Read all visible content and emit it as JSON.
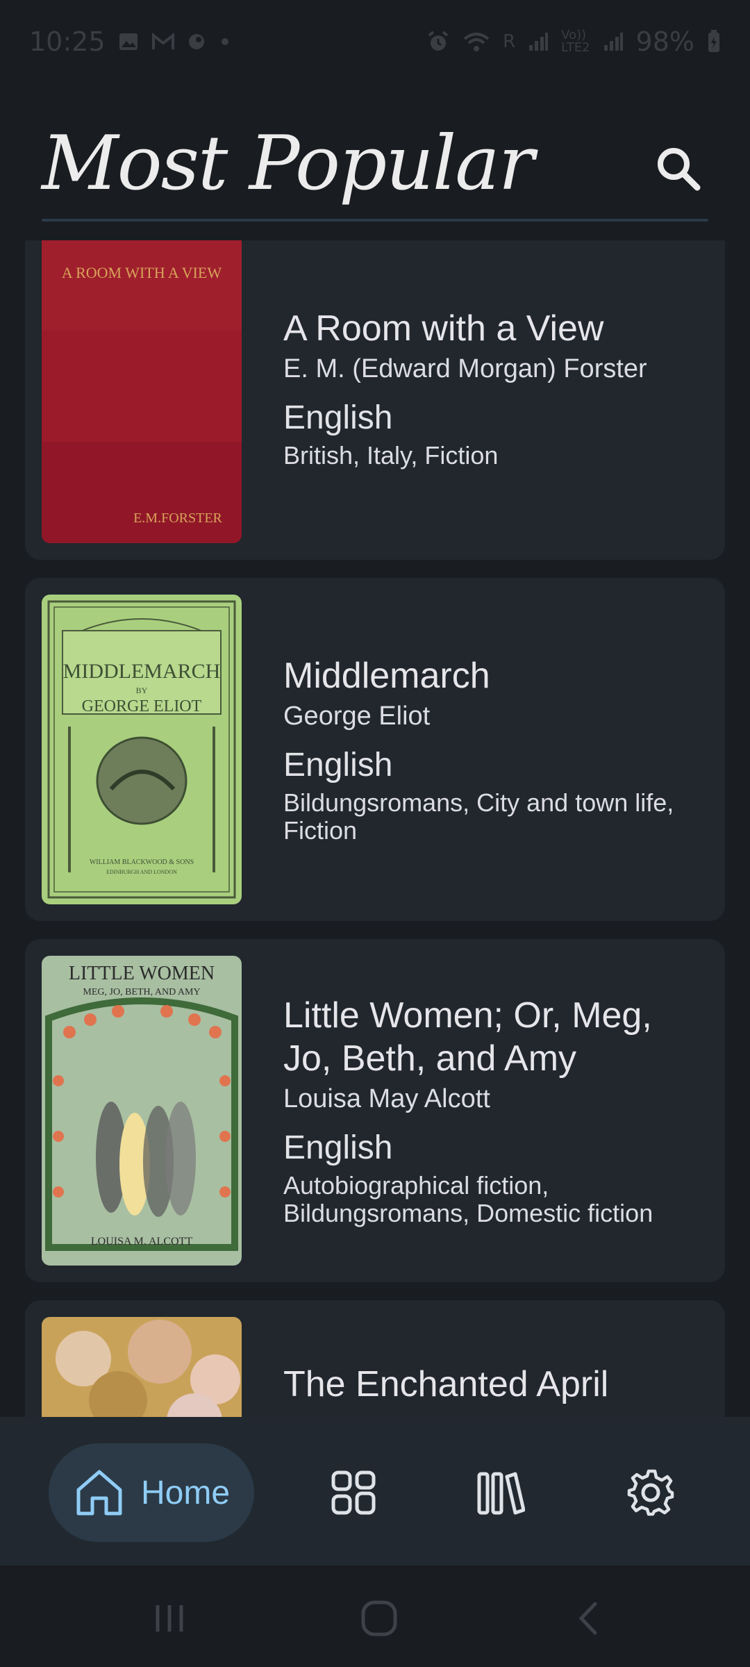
{
  "status_bar": {
    "time": "10:25",
    "left_icons": [
      "image-icon",
      "gmail-icon",
      "app-icon",
      "dot-icon"
    ],
    "right_icons": [
      "alarm-icon",
      "wifi-icon",
      "signal-icon",
      "volte-icon",
      "signal-icon",
      "battery-charging-icon"
    ],
    "r_label": "R",
    "volte_label": "Vo))\nLTE2",
    "battery": "98%"
  },
  "header": {
    "title": "Most Popular",
    "search_icon": "search-icon"
  },
  "books": [
    {
      "title": "A Room with a View",
      "author": "E. M. (Edward Morgan) Forster",
      "language": "English",
      "subjects": "British, Italy, Fiction",
      "cover": {
        "top_text": "A ROOM WITH A VIEW",
        "bottom_text": "E.M.FORSTER",
        "color": "#9b1b2b"
      }
    },
    {
      "title": "Middlemarch",
      "author": "George Eliot",
      "language": "English",
      "subjects": "Bildungsromans, City and town life, Fiction",
      "cover": {
        "title_text": "MIDDLEMARCH",
        "by_text": "BY",
        "author_text": "GEORGE ELIOT",
        "publisher_text": "WILLIAM BLACKWOOD & SONS",
        "place_text": "EDINBURGH AND LONDON",
        "color": "#a9cf7e"
      }
    },
    {
      "title": "Little Women; Or, Meg, Jo, Beth, and Amy",
      "author": "Louisa May Alcott",
      "language": "English",
      "subjects": "Autobiographical fiction, Bildungsromans, Domestic fiction",
      "cover": {
        "title_text": "LITTLE WOMEN",
        "sub_text": "MEG, JO, BETH, AND AMY",
        "author_text": "LOUISA M. ALCOTT",
        "color": "#a8bfa2"
      }
    },
    {
      "title": "The Enchanted April",
      "cover": {
        "color": "#c9a25a"
      }
    }
  ],
  "bottom_nav": {
    "items": [
      {
        "label": "Home",
        "icon": "home-icon",
        "selected": true
      },
      {
        "icon": "categories-icon"
      },
      {
        "icon": "library-icon"
      },
      {
        "icon": "settings-icon"
      }
    ]
  },
  "system_nav": {
    "icons": [
      "recents-icon",
      "home-circle-icon",
      "back-icon"
    ]
  },
  "colors": {
    "background": "#191c20",
    "card": "#21272d",
    "accent": "#8fcdf6",
    "nav_pill": "#2b3a46"
  }
}
